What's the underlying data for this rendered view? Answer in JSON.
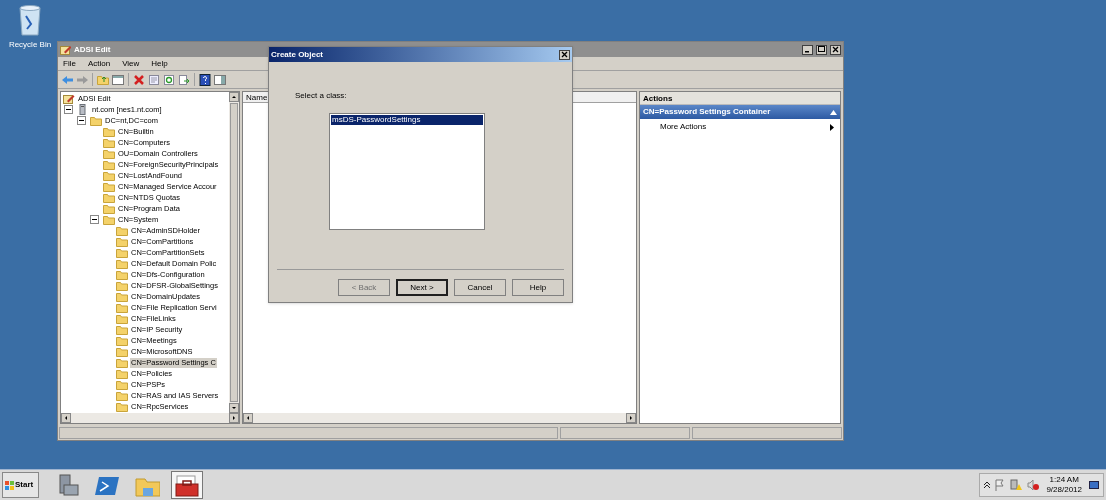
{
  "desktop_icons": [
    {
      "label": "Recycle Bin"
    }
  ],
  "window": {
    "title": "ADSI Edit"
  },
  "menu": [
    "File",
    "Action",
    "View",
    "Help"
  ],
  "tree": [
    {
      "label": "ADSI Edit",
      "kind": "app",
      "selected": false,
      "children": [
        {
          "label": "nt.com [nes1.nt.com]",
          "kind": "server",
          "selected": false,
          "expanded": true,
          "children": [
            {
              "label": "DC=nt,DC=com",
              "kind": "folder",
              "selected": false,
              "expanded": true,
              "children": [
                {
                  "label": "CN=Builtin",
                  "kind": "folder",
                  "selected": false
                },
                {
                  "label": "CN=Computers",
                  "kind": "folder",
                  "selected": false
                },
                {
                  "label": "OU=Domain Controllers",
                  "kind": "folder",
                  "selected": false
                },
                {
                  "label": "CN=ForeignSecurityPrincipals",
                  "kind": "folder",
                  "selected": false
                },
                {
                  "label": "CN=LostAndFound",
                  "kind": "folder",
                  "selected": false
                },
                {
                  "label": "CN=Managed Service Accour",
                  "kind": "folder",
                  "selected": false
                },
                {
                  "label": "CN=NTDS Quotas",
                  "kind": "folder",
                  "selected": false
                },
                {
                  "label": "CN=Program Data",
                  "kind": "folder",
                  "selected": false
                },
                {
                  "label": "CN=System",
                  "kind": "folder",
                  "selected": false,
                  "expanded": true,
                  "children": [
                    {
                      "label": "CN=AdminSDHolder",
                      "kind": "folder",
                      "selected": false
                    },
                    {
                      "label": "CN=ComPartitions",
                      "kind": "folder",
                      "selected": false
                    },
                    {
                      "label": "CN=ComPartitionSets",
                      "kind": "folder",
                      "selected": false
                    },
                    {
                      "label": "CN=Default Domain Polic",
                      "kind": "folder",
                      "selected": false
                    },
                    {
                      "label": "CN=Dfs-Configuration",
                      "kind": "folder",
                      "selected": false
                    },
                    {
                      "label": "CN=DFSR-GlobalSettings",
                      "kind": "folder",
                      "selected": false
                    },
                    {
                      "label": "CN=DomainUpdates",
                      "kind": "folder",
                      "selected": false
                    },
                    {
                      "label": "CN=File Replication Servi",
                      "kind": "folder",
                      "selected": false
                    },
                    {
                      "label": "CN=FileLinks",
                      "kind": "folder",
                      "selected": false
                    },
                    {
                      "label": "CN=IP Security",
                      "kind": "folder",
                      "selected": false
                    },
                    {
                      "label": "CN=Meetings",
                      "kind": "folder",
                      "selected": false
                    },
                    {
                      "label": "CN=MicrosoftDNS",
                      "kind": "folder",
                      "selected": false
                    },
                    {
                      "label": "CN=Password Settings C",
                      "kind": "folder",
                      "selected": true
                    },
                    {
                      "label": "CN=Policies",
                      "kind": "folder",
                      "selected": false
                    },
                    {
                      "label": "CN=PSPs",
                      "kind": "folder",
                      "selected": false
                    },
                    {
                      "label": "CN=RAS and IAS Servers",
                      "kind": "folder",
                      "selected": false
                    },
                    {
                      "label": "CN=RpcServices",
                      "kind": "folder",
                      "selected": false
                    }
                  ]
                }
              ]
            }
          ]
        }
      ]
    }
  ],
  "columns": [
    "Name"
  ],
  "actions": {
    "header": "Actions",
    "section": "CN=Password Settings Container",
    "items": [
      {
        "label": "More Actions"
      }
    ]
  },
  "dialog": {
    "title": "Create Object",
    "prompt": "Select a class:",
    "classes": [
      {
        "label": "msDS-PasswordSettings",
        "selected": true
      }
    ],
    "buttons": [
      {
        "label": "< Back",
        "disabled": true,
        "default": false
      },
      {
        "label": "Next >",
        "disabled": false,
        "default": true
      },
      {
        "label": "Cancel",
        "disabled": false,
        "default": false
      },
      {
        "label": "Help",
        "disabled": false,
        "default": false
      }
    ]
  },
  "taskbar": {
    "start": "Start",
    "apps": [
      {
        "kind": "server-manager",
        "selected": false
      },
      {
        "kind": "powershell",
        "selected": false
      },
      {
        "kind": "explorer",
        "selected": false
      },
      {
        "kind": "toolbox",
        "selected": true
      }
    ],
    "time": "1:24 AM",
    "date": "9/28/2012"
  }
}
